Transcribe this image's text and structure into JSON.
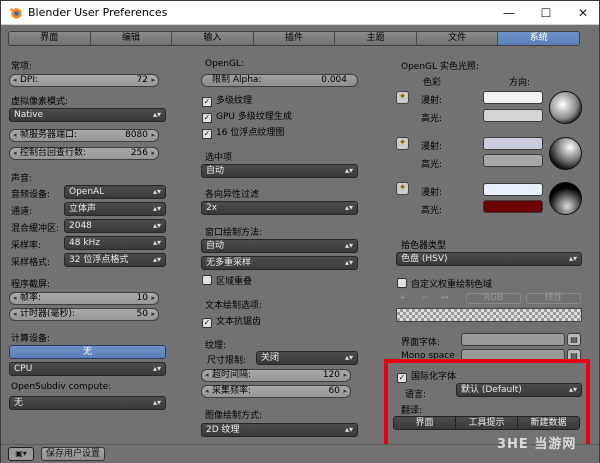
{
  "window": {
    "title": "Blender User Preferences",
    "controls": [
      "—",
      "☐",
      "✕"
    ]
  },
  "tabs": [
    "界面",
    "编辑",
    "输入",
    "插件",
    "主题",
    "文件",
    "系统"
  ],
  "active_tab": "系统",
  "left": {
    "general_label": "常项:",
    "dpi_label": "DPI:",
    "dpi_value": "72",
    "virtual_pixel_label": "虚拟像素模式:",
    "virtual_pixel_value": "Native",
    "frame_server_label": "帧服务器端口:",
    "frame_server_value": "8080",
    "console_label": "控制台回查行数:",
    "console_value": "256",
    "sound_label": "声音:",
    "audio_device_label": "音频设备:",
    "audio_device_value": "OpenAL",
    "channels_label": "通道:",
    "channels_value": "立体声",
    "mixing_buffer_label": "混合缓冲区:",
    "mixing_buffer_value": "2048",
    "sample_rate_label": "采样率:",
    "sample_rate_value": "48 kHz",
    "sample_format_label": "采样格式:",
    "sample_format_value": "32 位浮点格式",
    "screencast_label": "程序截屏:",
    "fps_label": "帧率:",
    "fps_value": "10",
    "wait_timer_label": "计时器(毫秒):",
    "wait_timer_value": "50",
    "compute_label": "计算设备:",
    "compute_none": "无",
    "compute_device": "CPU",
    "opensubdiv_label": "OpenSubdiv compute:",
    "opensubdiv_value": "无",
    "save_prefs": "保存用户设置"
  },
  "middle": {
    "opengl_label": "OpenGL:",
    "clip_alpha_label": "限制 Alpha:",
    "clip_alpha_value": "0.004",
    "mipmaps": "多级纹理",
    "gpu_mipmap": "GPU 多级纹理生成",
    "float_textures": "16 位浮点纹理图",
    "selection_label": "选中项",
    "selection_value": "自动",
    "anisotropic_label": "各向异性过滤",
    "anisotropic_value": "2x",
    "window_draw_label": "窗口绘制方法:",
    "window_draw_value": "自动",
    "multisample_value": "无多重采样",
    "region_overlap": "区域重叠",
    "text_draw_label": "文本绘制选项:",
    "text_antialias": "文本抗锯齿",
    "textures_label": "纹理:",
    "size_limit_label": "尺寸限制:",
    "size_limit_value": "关闭",
    "time_out_label": "超时间隔:",
    "time_out_value": "120",
    "collection_rate_label": "采集频率:",
    "collection_rate_value": "60",
    "image_draw_label": "图像绘制方式:",
    "image_draw_value": "2D 纹理"
  },
  "right": {
    "solid_lights_label": "OpenGL 实色光照:",
    "colour_label": "色彩",
    "direction_label": "方向:",
    "diffuse": "漫射:",
    "specular": "高光:",
    "lights": [
      {
        "diffuse": "#f2f2f2",
        "specular": "#d4d4d4"
      },
      {
        "diffuse": "#c8cde0",
        "specular": "#a8a8a8"
      },
      {
        "diffuse": "#e8eefc",
        "specular": "#6b0000"
      }
    ],
    "color_picker_label": "拾色器类型",
    "color_picker_value": "色盘 (HSV)",
    "custom_weight": "自定义权重绘制色域",
    "ramp_buttons": [
      "+",
      "−",
      "↔",
      "RGB",
      "线性"
    ],
    "interface_font_label": "界面字体:",
    "mono_font_label": "Mono space",
    "international_fonts": "国际化字体",
    "language_label": "语言:",
    "language_value": "默认 (Default)",
    "translate_label": "翻译:",
    "translate_buttons": [
      "界面",
      "工具提示",
      "新建数据"
    ]
  },
  "watermark": "3HE 当游网",
  "colors": {
    "accent": "#5a7fb8",
    "highlight": "#e60012",
    "panel": "#727272"
  }
}
